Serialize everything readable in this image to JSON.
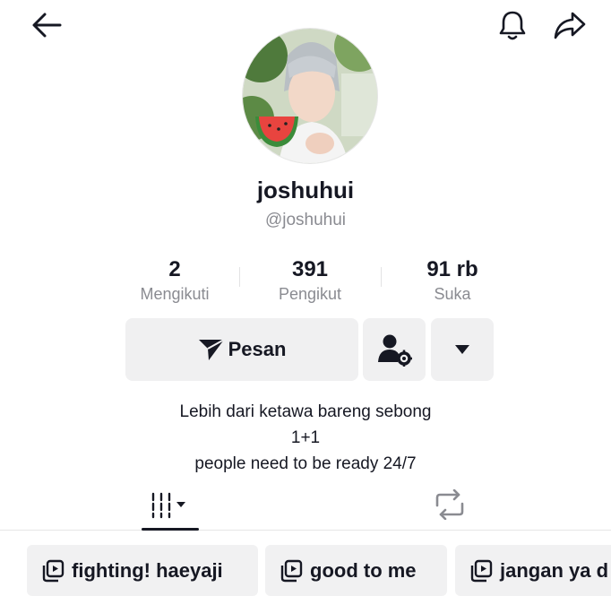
{
  "header": {
    "back_icon": "arrow-left-icon",
    "notification_icon": "bell-icon",
    "share_icon": "share-arrow-icon"
  },
  "profile": {
    "display_name": "joshuhui",
    "handle": "@joshuhui",
    "avatar_icon": "profile-photo"
  },
  "stats": [
    {
      "value": "2",
      "label": "Mengikuti"
    },
    {
      "value": "391",
      "label": "Pengikut"
    },
    {
      "value": "91 rb",
      "label": "Suka"
    }
  ],
  "actions": {
    "message_label": "Pesan",
    "message_icon": "send-icon",
    "friend_settings_icon": "user-gear-icon",
    "more_icon": "caret-down-icon"
  },
  "bio": {
    "lines": [
      "Lebih dari ketawa bareng sebong",
      "1+1",
      "people need to be ready 24/7"
    ]
  },
  "tabs": {
    "videos_icon": "grid-bars-icon",
    "repost_icon": "repost-icon"
  },
  "playlists": [
    {
      "label": "fighting! haeyaji",
      "icon": "playlist-icon"
    },
    {
      "label": "good to me",
      "icon": "playlist-icon"
    },
    {
      "label": "jangan ya d",
      "icon": "playlist-icon"
    }
  ],
  "colors": {
    "text_primary": "#161823",
    "text_secondary": "#8a8b91",
    "button_bg": "#f0f0f1"
  }
}
